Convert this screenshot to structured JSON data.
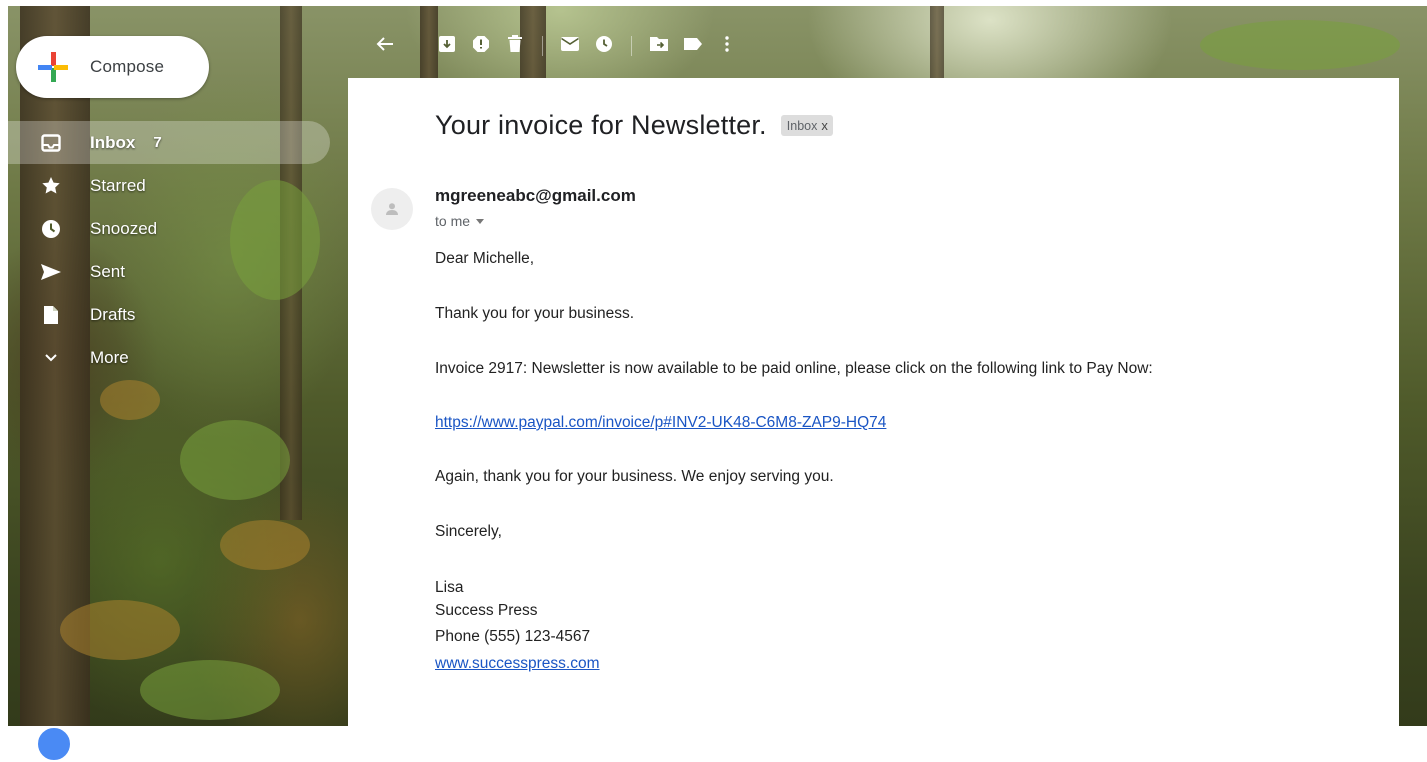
{
  "sidebar": {
    "compose_label": "Compose",
    "items": [
      {
        "label": "Inbox",
        "count": "7",
        "icon": "inbox-icon",
        "active": true
      },
      {
        "label": "Starred",
        "icon": "star-icon"
      },
      {
        "label": "Snoozed",
        "icon": "clock-icon"
      },
      {
        "label": "Sent",
        "icon": "send-icon"
      },
      {
        "label": "Drafts",
        "icon": "draft-icon"
      },
      {
        "label": "More",
        "icon": "chevron-down-icon"
      }
    ]
  },
  "toolbar": {
    "icons": [
      "back-arrow-icon",
      "archive-icon",
      "report-spam-icon",
      "delete-icon",
      "mark-unread-icon",
      "snooze-icon",
      "move-to-icon",
      "label-icon",
      "more-vert-icon"
    ]
  },
  "message": {
    "subject": "Your invoice for Newsletter.",
    "label_chip": "Inbox",
    "label_chip_close": "x",
    "sender": "mgreeneabc@gmail.com",
    "recipient": "to me",
    "greeting": "Dear Michelle,",
    "line1": "Thank you for your business.",
    "line2": "Invoice 2917: Newsletter is now available to be paid online, please click on the following link to Pay Now:",
    "link": "https://www.paypal.com/invoice/p#INV2-UK48-C6M8-ZAP9-HQ74",
    "line3": "Again, thank you for your business. We enjoy serving you.",
    "closing": "Sincerely,",
    "signature": {
      "name": "Lisa",
      "company": "Success Press",
      "phone": "Phone (555) 123-4567",
      "website": "www.successpress.com"
    }
  },
  "colors": {
    "link": "#1a55c4",
    "text": "#222222",
    "chip_bg": "#dddddd"
  }
}
